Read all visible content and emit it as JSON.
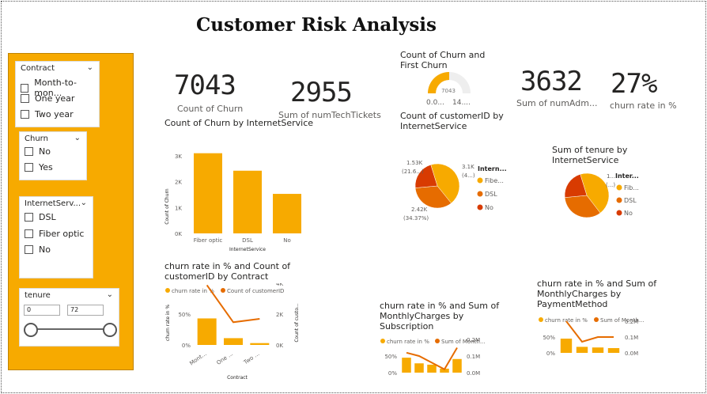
{
  "title": "Customer Risk Analysis",
  "colors": {
    "orange": "#f7aa00",
    "dark_orange": "#e66c00",
    "red": "#d83b01",
    "text": "#252423"
  },
  "slicers": {
    "contract": {
      "label": "Contract",
      "options": [
        "Month-to-mon...",
        "One year",
        "Two year"
      ]
    },
    "churn": {
      "label": "Churn",
      "options": [
        "No",
        "Yes"
      ]
    },
    "internet": {
      "label": "InternetServ...",
      "options": [
        "DSL",
        "Fiber optic",
        "No"
      ]
    },
    "tenure": {
      "label": "tenure",
      "min": "0",
      "max": "72",
      "range_fraction": [
        0,
        1
      ]
    }
  },
  "kpis": {
    "count_churn": {
      "value": "7043",
      "label": "Count of Churn"
    },
    "sum_tickets": {
      "value": "2955",
      "label": "Sum of numTechTickets"
    },
    "sum_numadm": {
      "value": "3632",
      "label": "Sum of numAdm..."
    },
    "churn_rate": {
      "value": "27%",
      "label": "churn rate in %"
    }
  },
  "gauge": {
    "title_line1": "Count of Churn and",
    "title_line2": "First Churn",
    "value": "7043",
    "min": "0.0...",
    "max": "14....",
    "fraction": 0.5
  },
  "chart_data": [
    {
      "type": "bar",
      "title": "Count of Churn by InternetService",
      "categories": [
        "Fiber optic",
        "DSL",
        "No"
      ],
      "values": [
        3096,
        2421,
        1526
      ],
      "xlabel": "InternetService",
      "ylabel": "Count of Churn",
      "yticks": [
        "0K",
        "1K",
        "2K",
        "3K"
      ],
      "ylim": [
        0,
        3300
      ]
    },
    {
      "type": "pie",
      "title_line1": "Count of customerID by",
      "title_line2": "InternetService",
      "legend_title": "Intern...",
      "categories": [
        "Fibe...",
        "DSL",
        "No"
      ],
      "values": [
        3096,
        2421,
        1526
      ],
      "labels": [
        "3.1K",
        "(4...)",
        "2.42K",
        "(34.37%)",
        "1.53K",
        "(21.6...)"
      ]
    },
    {
      "type": "pie",
      "title_line1": "Sum of tenure by",
      "title_line2": "InternetService",
      "legend_title": "Inter...",
      "categories": [
        "Fib...",
        "DSL",
        "No"
      ],
      "values": [
        102,
        78,
        50
      ],
      "labels": [
        "1...",
        "(...)"
      ]
    },
    {
      "type": "bar",
      "title_line1": "churn rate in % and Count of",
      "title_line2": "customerID by Contract",
      "legend": [
        "churn rate in %",
        "Count of customerID"
      ],
      "categories": [
        "Mont...",
        "One ...",
        "Two ..."
      ],
      "values": [
        0.43,
        0.11,
        0.03
      ],
      "line_values": [
        3875,
        1473,
        1695
      ],
      "xlabel": "Contract",
      "ylabel": "churn rate in %",
      "y2label": "Count of custo...",
      "yticks": [
        "0%",
        "50%"
      ],
      "y2ticks": [
        "0K",
        "2K",
        "4K"
      ]
    },
    {
      "type": "bar",
      "title_line1": "churn rate in % and Sum of",
      "title_line2": "MonthlyCharges by",
      "title_line3": "Subscription",
      "legend": [
        "churn rate in %",
        "Sum of Month..."
      ],
      "values": [
        0.45,
        0.28,
        0.24,
        0.12,
        0.41
      ],
      "line_values": [
        0.12,
        0.1,
        0.06,
        0.02,
        0.15
      ],
      "yticks": [
        "0%",
        "50%"
      ],
      "y2ticks": [
        "0.0M",
        "0.1M",
        "0.2M"
      ]
    },
    {
      "type": "bar",
      "title_line1": "churn rate in % and Sum of",
      "title_line2": "MonthlyCharges by",
      "title_line3": "PaymentMethod",
      "legend": [
        "churn rate in %",
        "Sum of Month..."
      ],
      "values": [
        0.45,
        0.19,
        0.17,
        0.15
      ],
      "line_values": [
        0.2,
        0.07,
        0.1,
        0.1
      ],
      "yticks": [
        "0%",
        "50%"
      ],
      "y2ticks": [
        "0.0M",
        "0.1M",
        "0.2M"
      ]
    }
  ]
}
